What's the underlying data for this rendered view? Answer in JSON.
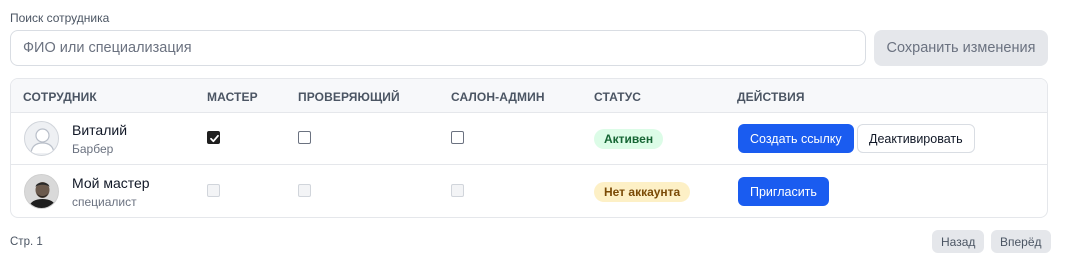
{
  "search": {
    "label": "Поиск сотрудника",
    "placeholder": "ФИО или специализация",
    "value": ""
  },
  "save_button": "Сохранить изменения",
  "columns": [
    "СОТРУДНИК",
    "МАСТЕР",
    "ПРОВЕРЯЮЩИЙ",
    "САЛОН-АДМИН",
    "СТАТУС",
    "ДЕЙСТВИЯ"
  ],
  "rows": [
    {
      "name": "Виталий",
      "role": "Барбер",
      "avatar": "user-placeholder-icon",
      "master": true,
      "reviewer": false,
      "salon_admin": false,
      "checkboxes_enabled": true,
      "status": "Активен",
      "status_color": "#dcfce7",
      "actions": [
        "Создать ссылку",
        "Деактивировать"
      ]
    },
    {
      "name": "Мой мастер",
      "role": "специалист",
      "avatar": "user-photo",
      "master": false,
      "reviewer": false,
      "salon_admin": false,
      "checkboxes_enabled": false,
      "status": "Нет аккаунта",
      "status_color": "#fdf0c6",
      "actions": [
        "Пригласить"
      ]
    }
  ],
  "pagination": {
    "page_label": "Стр. 1",
    "prev": "Назад",
    "next": "Вперёд"
  },
  "colors": {
    "primary": "#1a5cf0",
    "active_badge": "#dcfce7",
    "no_account_badge": "#fdf0c6"
  }
}
